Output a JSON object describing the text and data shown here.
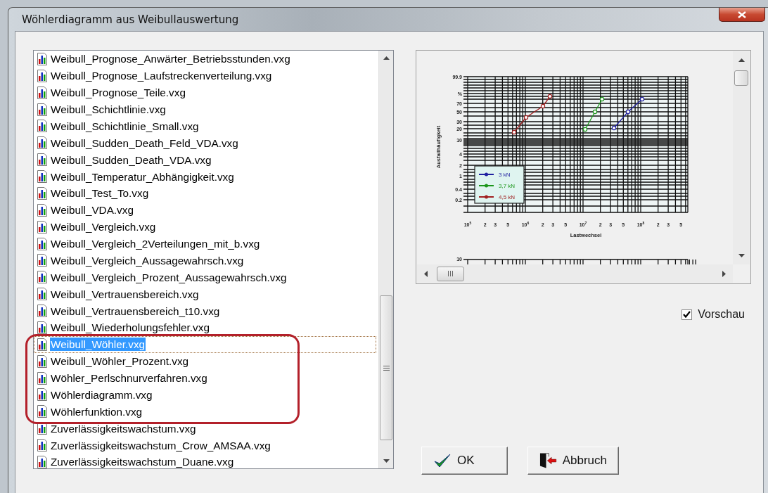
{
  "window": {
    "title": "Wöhlerdiagramm aus Weibullauswertung"
  },
  "file_list": {
    "items": [
      {
        "label": "Weibull_Prognose_Anwärter_Betriebsstunden.vxg",
        "selected": false,
        "circled": false
      },
      {
        "label": "Weibull_Prognose_Laufstreckenverteilung.vxg",
        "selected": false,
        "circled": false
      },
      {
        "label": "Weibull_Prognose_Teile.vxg",
        "selected": false,
        "circled": false
      },
      {
        "label": "Weibull_Schichtlinie.vxg",
        "selected": false,
        "circled": false
      },
      {
        "label": "Weibull_Schichtlinie_Small.vxg",
        "selected": false,
        "circled": false
      },
      {
        "label": "Weibull_Sudden_Death_Feld_VDA.vxg",
        "selected": false,
        "circled": false
      },
      {
        "label": "Weibull_Sudden_Death_VDA.vxg",
        "selected": false,
        "circled": false
      },
      {
        "label": "Weibull_Temperatur_Abhängigkeit.vxg",
        "selected": false,
        "circled": false
      },
      {
        "label": "Weibull_Test_To.vxg",
        "selected": false,
        "circled": false
      },
      {
        "label": "Weibull_VDA.vxg",
        "selected": false,
        "circled": false
      },
      {
        "label": "Weibull_Vergleich.vxg",
        "selected": false,
        "circled": false
      },
      {
        "label": "Weibull_Vergleich_2Verteilungen_mit_b.vxg",
        "selected": false,
        "circled": false
      },
      {
        "label": "Weibull_Vergleich_Aussagewahrsch.vxg",
        "selected": false,
        "circled": false
      },
      {
        "label": "Weibull_Vergleich_Prozent_Aussagewahrsch.vxg",
        "selected": false,
        "circled": false
      },
      {
        "label": "Weibull_Vertrauensbereich.vxg",
        "selected": false,
        "circled": false
      },
      {
        "label": "Weibull_Vertrauensbereich_t10.vxg",
        "selected": false,
        "circled": false
      },
      {
        "label": "Weibull_Wiederholungsfehler.vxg",
        "selected": false,
        "circled": false
      },
      {
        "label": "Weibull_Wöhler.vxg",
        "selected": true,
        "circled": true
      },
      {
        "label": "Weibull_Wöhler_Prozent.vxg",
        "selected": false,
        "circled": true
      },
      {
        "label": "Wöhler_Perlschnurverfahren.vxg",
        "selected": false,
        "circled": true
      },
      {
        "label": "Wöhlerdiagramm.vxg",
        "selected": false,
        "circled": true
      },
      {
        "label": "Wöhlerfunktion.vxg",
        "selected": false,
        "circled": true
      },
      {
        "label": "Zuverlässigkeitswachstum.vxg",
        "selected": false,
        "circled": false
      },
      {
        "label": "Zuverlässigkeitswachstum_Crow_AMSAA.vxg",
        "selected": false,
        "circled": false
      },
      {
        "label": "Zuverlässigkeitswachstum_Duane.vxg",
        "selected": false,
        "circled": false
      }
    ]
  },
  "preview": {
    "y_axis_title": "Ausfallhäufigkeit",
    "x_axis_title": "Lastwechsel",
    "y_tick_labels": [
      "99.9",
      "%",
      "70",
      "50",
      "30",
      "20",
      "10",
      "4",
      "2",
      "1",
      "0.4",
      "0.2"
    ],
    "x_tick_labels": [
      "10$^{5}$",
      "2",
      "3",
      "5",
      "10$^{6}$",
      "2",
      "3",
      "5",
      "10$^{7}$",
      "2",
      "3",
      "5",
      "10$^{8}$",
      "2",
      "3",
      "5"
    ],
    "legend": [
      {
        "label": "3 kN",
        "color": "#2020a0"
      },
      {
        "label": "3,7 kN",
        "color": "#1a961a"
      },
      {
        "label": "4,5 kN",
        "color": "#a02020"
      }
    ],
    "next_chart_y_tick_labels": [
      "10"
    ]
  },
  "preview_checkbox": {
    "label": "Vorschau",
    "checked": true
  },
  "buttons": [
    {
      "label": "OK",
      "kind": "ok"
    },
    {
      "label": "Abbruch",
      "kind": "cancel"
    }
  ]
}
